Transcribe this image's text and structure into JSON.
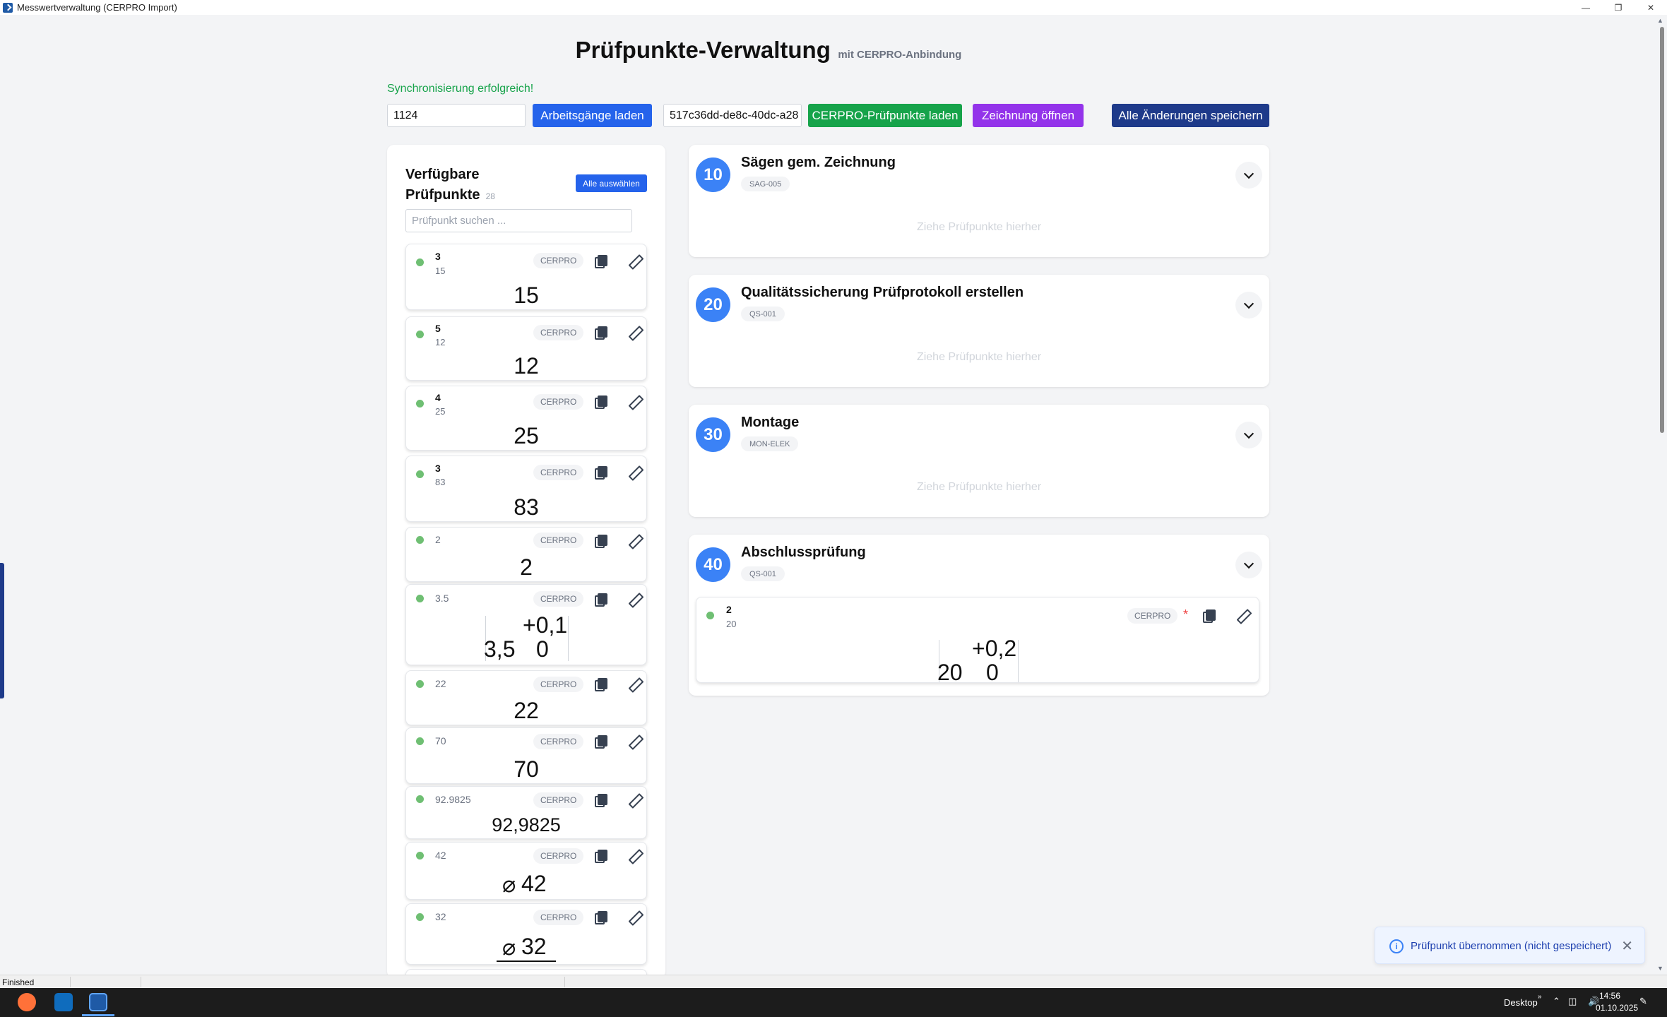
{
  "window": {
    "title": "Messwertverwaltung (CERPRO Import)"
  },
  "header": {
    "title": "Prüfpunkte-Verwaltung",
    "subtitle": "mit CERPRO-Anbindung"
  },
  "sync_message": "Synchronisierung erfolgreich!",
  "toolbar": {
    "order_input": "1124",
    "load_ops_label": "Arbeitsgänge laden",
    "guid_input": "517c36dd-de8c-40dc-a28",
    "load_points_label": "CERPRO-Prüfpunkte laden",
    "open_drawing_label": "Zeichnung öffnen",
    "save_all_label": "Alle Änderungen speichern",
    "colors": {
      "blue": "#2563eb",
      "green": "#16a34a",
      "purple": "#9333ea",
      "navy": "#1e3a8a"
    }
  },
  "available": {
    "title": "Verfügbare Prüfpunkte",
    "count": "28",
    "select_all_label": "Alle auswählen",
    "search_placeholder": "Prüfpunkt suchen ...",
    "badge": "CERPRO",
    "items": [
      {
        "name": "3",
        "sub": "15",
        "value": "15"
      },
      {
        "name": "5",
        "sub": "12",
        "value": "12"
      },
      {
        "name": "4",
        "sub": "25",
        "value": "25"
      },
      {
        "name": "3",
        "sub": "83",
        "value": "83"
      },
      {
        "name": "2",
        "value": "2"
      },
      {
        "name": "3.5",
        "value_main": "3,5",
        "tol_upper": "+0,1",
        "tol_lower": "0"
      },
      {
        "name": "22",
        "value": "22"
      },
      {
        "name": "70",
        "value": "70"
      },
      {
        "name": "92.9825",
        "value": "92,9825"
      },
      {
        "name": "42",
        "value_dia": "⌀",
        "value": "42"
      },
      {
        "name": "32",
        "value_dia": "⌀",
        "value": "32"
      }
    ]
  },
  "operations": [
    {
      "number": "10",
      "title": "Sägen gem. Zeichnung",
      "code": "SAG-005",
      "hint": "Ziehe Prüfpunkte hierher"
    },
    {
      "number": "20",
      "title": "Qualitätssicherung Prüfprotokoll erstellen",
      "code": "QS-001",
      "hint": "Ziehe Prüfpunkte hierher"
    },
    {
      "number": "30",
      "title": "Montage",
      "code": "MON-ELEK",
      "hint": "Ziehe Prüfpunkte hierher"
    },
    {
      "number": "40",
      "title": "Abschlussprüfung",
      "code": "QS-001",
      "point": {
        "name": "2",
        "sub": "20",
        "badge": "CERPRO",
        "modified_marker": "*",
        "value_main": "20",
        "tol_upper": "+0,2",
        "tol_lower": "0"
      }
    }
  ],
  "toast": {
    "message": "Prüfpunkt übernommen (nicht gespeichert)"
  },
  "status": {
    "text": "Finished"
  },
  "taskbar": {
    "desktop_label": "Desktop",
    "time": "14:56",
    "date": "01.10.2025"
  }
}
